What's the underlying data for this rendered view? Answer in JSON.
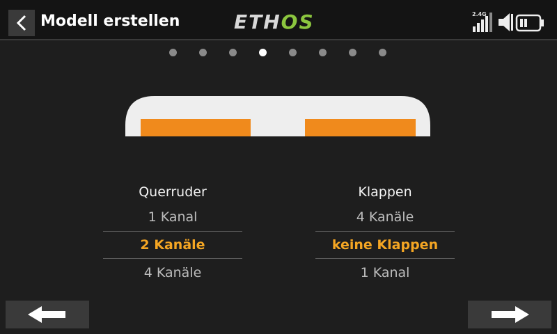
{
  "header": {
    "title": "Modell erstellen",
    "logo_eth": "ETH",
    "logo_os": "OS",
    "signal_band": "2.4G"
  },
  "pager": {
    "total_pages": 8,
    "current_page": 4
  },
  "colors": {
    "accent": "#f5a623",
    "wing_fill": "#eeeeee",
    "control_surface": "#f08a1c",
    "logo_green": "#8cc63f"
  },
  "ailerons": {
    "heading": "Querruder",
    "options": [
      "1 Kanal",
      "2 Kanäle",
      "4 Kanäle"
    ],
    "selected": "2 Kanäle"
  },
  "flaps": {
    "heading": "Klappen",
    "options": [
      "4 Kanäle",
      "keine Klappen",
      "1 Kanal"
    ],
    "selected": "keine Klappen"
  },
  "nav": {
    "prev_icon": "arrow-left-icon",
    "next_icon": "arrow-right-icon"
  }
}
